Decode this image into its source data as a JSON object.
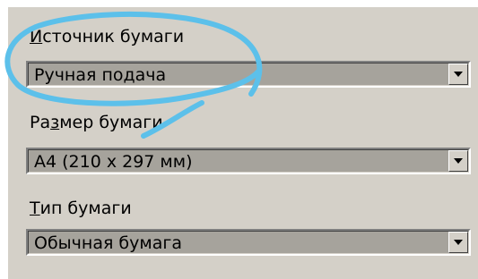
{
  "paper_source": {
    "label_accel": "И",
    "label_rest": "сточник бумаги",
    "value": "Ручная подача"
  },
  "paper_size": {
    "label_pre": "Ра",
    "label_accel": "з",
    "label_rest": "мер бумаги",
    "value": "A4 (210 x 297 мм)"
  },
  "paper_type": {
    "label_accel": "Т",
    "label_rest": "ип бумаги",
    "value": "Обычная бумага"
  },
  "icons": {
    "dropdown": "chevron-down-icon"
  },
  "colors": {
    "dialog_bg": "#d4d0c8",
    "field_bg": "#a6a39c",
    "annotation": "#5cc0ea"
  }
}
